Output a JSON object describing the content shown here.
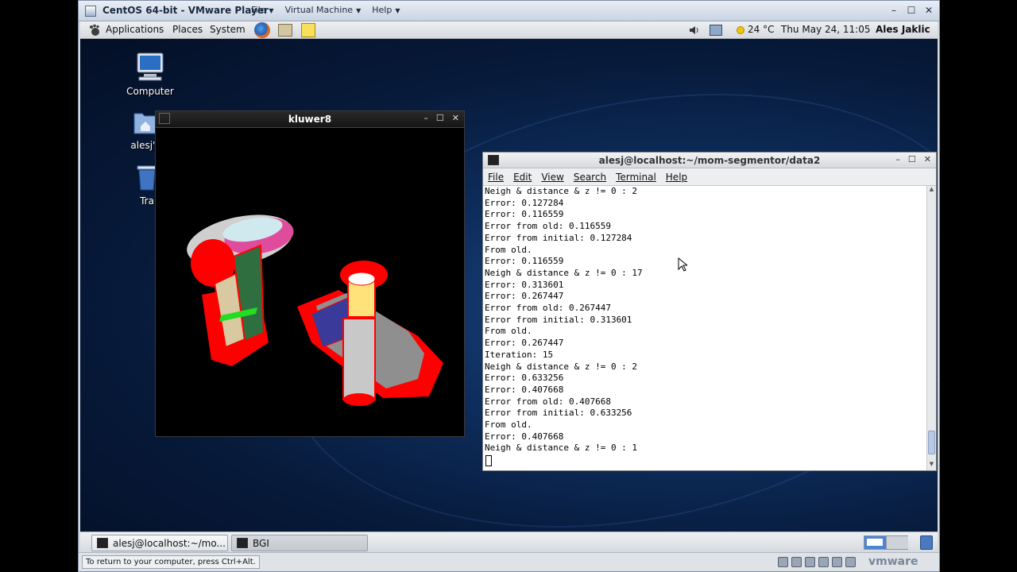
{
  "vmware": {
    "title": "CentOS 64-bit - VMware Player",
    "menus": [
      {
        "label": "File"
      },
      {
        "label": "Virtual Machine"
      },
      {
        "label": "Help"
      }
    ],
    "status_hint": "To return to your computer, press Ctrl+Alt.",
    "brand": "vmware"
  },
  "top_panel": {
    "applications": "Applications",
    "places": "Places",
    "system": "System",
    "weather": "24 °C",
    "clock": "Thu May 24, 11:05",
    "user": "Ales Jaklic"
  },
  "desktop_icons": [
    {
      "label": "Computer",
      "icon": "computer-icon"
    },
    {
      "label": "alesj's",
      "icon": "home-folder-icon"
    },
    {
      "label": "Tra",
      "icon": "trash-icon"
    }
  ],
  "kluwer_window": {
    "title": "kluwer8"
  },
  "terminal": {
    "title": "alesj@localhost:~/mom-segmentor/data2",
    "menu": [
      "File",
      "Edit",
      "View",
      "Search",
      "Terminal",
      "Help"
    ],
    "lines": [
      "Neigh & distance & z != 0 : 2",
      "Error: 0.127284",
      "Error: 0.116559",
      "Error from old: 0.116559",
      "Error from initial: 0.127284",
      "From old.",
      "Error: 0.116559",
      "Neigh & distance & z != 0 : 17",
      "Error: 0.313601",
      "Error: 0.267447",
      "Error from old: 0.267447",
      "Error from initial: 0.313601",
      "From old.",
      "Error: 0.267447",
      "Iteration: 15",
      "Neigh & distance & z != 0 : 2",
      "Error: 0.633256",
      "Error: 0.407668",
      "Error from old: 0.407668",
      "Error from initial: 0.633256",
      "From old.",
      "Error: 0.407668",
      "Neigh & distance & z != 0 : 1"
    ]
  },
  "taskbar": [
    {
      "label": "alesj@localhost:~/mo..."
    },
    {
      "label": "BGI"
    }
  ]
}
